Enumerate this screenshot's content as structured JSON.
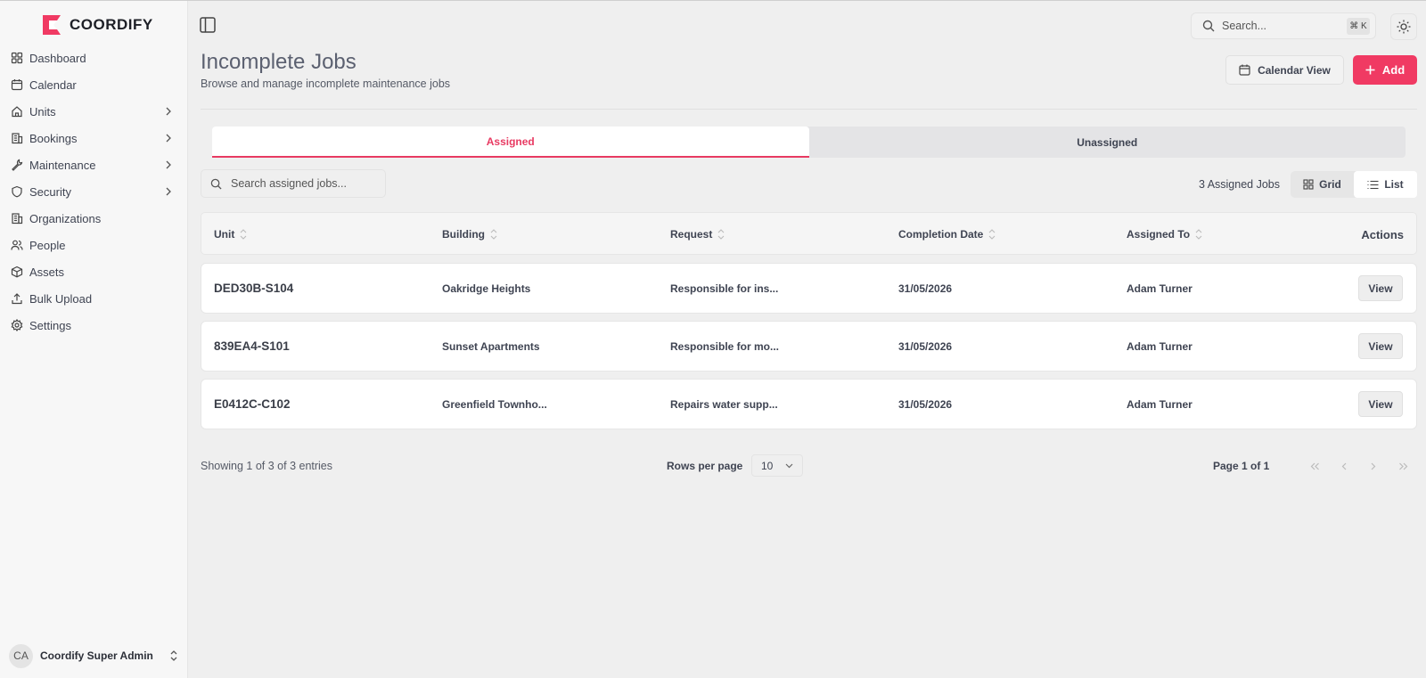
{
  "brand": {
    "name": "COORDIFY",
    "accent": "#f03a63"
  },
  "sidebar": {
    "items": [
      {
        "label": "Dashboard",
        "icon": "dashboard-icon",
        "has_children": false
      },
      {
        "label": "Calendar",
        "icon": "calendar-icon",
        "has_children": false
      },
      {
        "label": "Units",
        "icon": "home-icon",
        "has_children": true
      },
      {
        "label": "Bookings",
        "icon": "building-icon",
        "has_children": true
      },
      {
        "label": "Maintenance",
        "icon": "wrench-icon",
        "has_children": true
      },
      {
        "label": "Security",
        "icon": "shield-icon",
        "has_children": true
      },
      {
        "label": "Organizations",
        "icon": "building-icon",
        "has_children": false
      },
      {
        "label": "People",
        "icon": "users-icon",
        "has_children": false
      },
      {
        "label": "Assets",
        "icon": "box-icon",
        "has_children": false
      },
      {
        "label": "Bulk Upload",
        "icon": "upload-icon",
        "has_children": false
      },
      {
        "label": "Settings",
        "icon": "gear-icon",
        "has_children": false
      }
    ],
    "user": {
      "initials": "CA",
      "name": "Coordify Super Admin"
    }
  },
  "topbar": {
    "search_placeholder": "Search...",
    "shortcut": "⌘ K"
  },
  "header": {
    "title": "Incomplete Jobs",
    "subtitle": "Browse and manage incomplete maintenance jobs",
    "calendar_label": "Calendar View",
    "add_label": "Add"
  },
  "tabs": [
    {
      "label": "Assigned",
      "active": true
    },
    {
      "label": "Unassigned",
      "active": false
    }
  ],
  "toolbar": {
    "search_placeholder": "Search assigned jobs...",
    "job_count": "3 Assigned Jobs",
    "grid_label": "Grid",
    "list_label": "List"
  },
  "table": {
    "columns": [
      "Unit",
      "Building",
      "Request",
      "Completion Date",
      "Assigned To",
      "Actions"
    ],
    "rows": [
      {
        "unit": "DED30B-S104",
        "building": "Oakridge Heights",
        "request": "Responsible for ins...",
        "date": "31/05/2026",
        "assigned": "Adam Turner",
        "action": "View"
      },
      {
        "unit": "839EA4-S101",
        "building": "Sunset Apartments",
        "request": "Responsible for mo...",
        "date": "31/05/2026",
        "assigned": "Adam Turner",
        "action": "View"
      },
      {
        "unit": "E0412C-C102",
        "building": "Greenfield Townho...",
        "request": "Repairs water supp...",
        "date": "31/05/2026",
        "assigned": "Adam Turner",
        "action": "View"
      }
    ]
  },
  "footer": {
    "showing": "Showing 1 of 3 of 3 entries",
    "rows_per_page_label": "Rows per page",
    "rows_per_page_value": "10",
    "page_info": "Page 1 of 1"
  }
}
